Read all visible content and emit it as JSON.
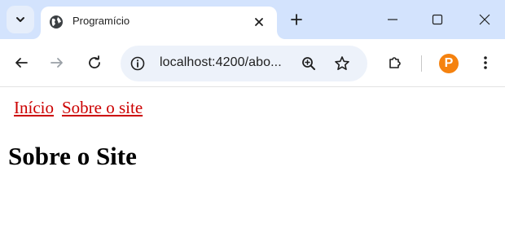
{
  "browser": {
    "tab_title": "Programício",
    "url": "localhost:4200/abo...",
    "profile_letter": "P"
  },
  "colors": {
    "tab_strip": "#d3e3fd",
    "omnibox": "#edf2fa",
    "link": "#cc0000",
    "profile": "#f5820f"
  },
  "icons": {
    "tab_search": "chevron-down-icon",
    "favicon": "globe-icon",
    "tab_close": "close-icon",
    "new_tab": "plus-icon",
    "minimize": "minimize-icon",
    "maximize": "maximize-icon",
    "window_close": "close-icon",
    "back": "back-arrow-icon",
    "forward": "forward-arrow-icon",
    "reload": "reload-icon",
    "site_info": "info-icon",
    "zoom": "zoom-icon",
    "bookmark": "star-icon",
    "extensions": "puzzle-icon",
    "menu": "kebab-menu-icon"
  },
  "page": {
    "nav": [
      {
        "label": "Início"
      },
      {
        "label": "Sobre o site"
      }
    ],
    "heading": "Sobre o Site"
  }
}
